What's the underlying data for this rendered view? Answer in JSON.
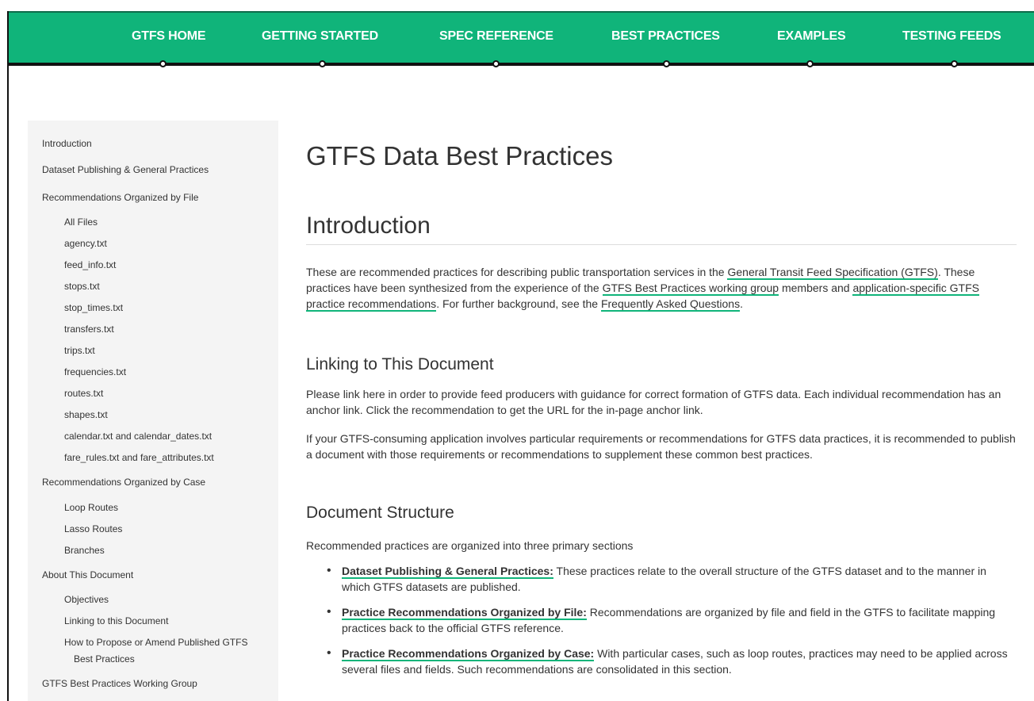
{
  "nav": {
    "items": [
      {
        "label": "GTFS HOME"
      },
      {
        "label": "GETTING STARTED"
      },
      {
        "label": "SPEC REFERENCE"
      },
      {
        "label": "BEST PRACTICES"
      },
      {
        "label": "EXAMPLES"
      },
      {
        "label": "TESTING FEEDS"
      }
    ]
  },
  "sidebar": {
    "items": [
      {
        "label": "Introduction",
        "level": 1
      },
      {
        "label": "Dataset Publishing & General Practices",
        "level": 1
      },
      {
        "label": "Recommendations Organized by File",
        "level": 1
      },
      {
        "label": "All Files",
        "level": 2
      },
      {
        "label": "agency.txt",
        "level": 2
      },
      {
        "label": "feed_info.txt",
        "level": 2
      },
      {
        "label": "stops.txt",
        "level": 2
      },
      {
        "label": "stop_times.txt",
        "level": 2
      },
      {
        "label": "transfers.txt",
        "level": 2
      },
      {
        "label": "trips.txt",
        "level": 2
      },
      {
        "label": "frequencies.txt",
        "level": 2
      },
      {
        "label": "routes.txt",
        "level": 2
      },
      {
        "label": "shapes.txt",
        "level": 2
      },
      {
        "label": "calendar.txt and calendar_dates.txt",
        "level": 2
      },
      {
        "label": "fare_rules.txt and fare_attributes.txt",
        "level": 2
      },
      {
        "label": "Recommendations Organized by Case",
        "level": 1
      },
      {
        "label": "Loop Routes",
        "level": 2
      },
      {
        "label": "Lasso Routes",
        "level": 2
      },
      {
        "label": "Branches",
        "level": 2
      },
      {
        "label": "About This Document",
        "level": 1
      },
      {
        "label": "Objectives",
        "level": 2
      },
      {
        "label": "Linking to this Document",
        "level": 2
      },
      {
        "label": "How to Propose or Amend Published GTFS",
        "level": 2
      },
      {
        "label": "Best Practices",
        "level": 2
      },
      {
        "label": "GTFS Best Practices Working Group",
        "level": 1
      }
    ]
  },
  "main": {
    "title": "GTFS Data Best Practices",
    "intro_heading": "Introduction",
    "intro": {
      "t1": "These are recommended practices for describing public transportation services in the ",
      "link1": "General Transit Feed Specification (GTFS)",
      "t2": ". These practices have been synthesized from the experience of the ",
      "link2": "GTFS Best Practices working group",
      "t3": " members and ",
      "link3": "application-specific GTFS practice recommendations",
      "t4": ". For further background, see the ",
      "link4": "Frequently Asked Questions",
      "t5": "."
    },
    "linking_heading": "Linking to This Document",
    "linking_p1": "Please link here in order to provide feed producers with guidance for correct formation of GTFS data. Each individual recommendation has an anchor link. Click the recommendation to get the URL for the in-page anchor link.",
    "linking_p2": "If your GTFS-consuming application involves particular requirements or recommendations for GTFS data practices, it is recommended to publish a document with those requirements or recommendations to supplement these common best practices.",
    "structure_heading": "Document Structure",
    "structure_p": "Recommended practices are organized into three primary sections",
    "bullets": [
      {
        "link": "Dataset Publishing & General Practices:",
        "text": " These practices relate to the overall structure of the GTFS dataset and to the manner in which GTFS datasets are published."
      },
      {
        "link": "Practice Recommendations Organized by File:",
        "text": " Recommendations are organized by file and field in the GTFS to facilitate mapping practices back to the official GTFS reference."
      },
      {
        "link": "Practice Recommendations Organized by Case:",
        "text": " With particular cases, such as loop routes, practices may need to be applied across several files and fields. Such recommendations are consolidated in this section."
      }
    ]
  },
  "colors": {
    "brand": "#10b47a",
    "text": "#333333",
    "sidebar_bg": "#f4f4f4"
  }
}
